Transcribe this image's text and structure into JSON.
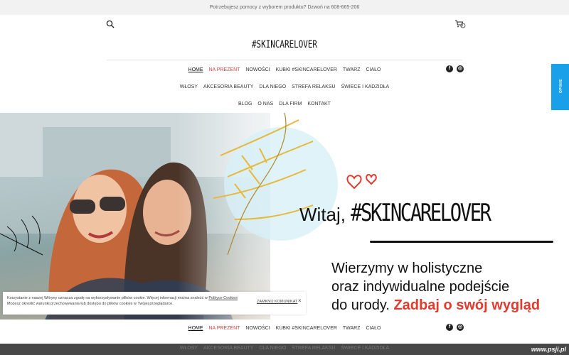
{
  "topbar": {
    "text": "Potrzebujesz pomocy z wyborem produktu? Dzwoń na 608-665-206"
  },
  "header": {
    "logo": "#SKINCARELOVER",
    "cart_count": "0",
    "search_icon": "search-icon",
    "cart_icon": "cart-icon"
  },
  "nav": {
    "row1": [
      "HOME",
      "NA PREZENT",
      "NOWOŚCI",
      "KUBKI #SKINCARELOVER",
      "TWARZ",
      "CIAŁO"
    ],
    "row2": [
      "WŁOSY",
      "AKCESORIA BEAUTY",
      "DLA NIEGO",
      "STREFA RELAKSU",
      "ŚWIECE I KADZIDŁA"
    ],
    "row3": [
      "BLOG",
      "O NAS",
      "DLA FIRM",
      "KONTAKT"
    ],
    "active_color": "#e0403a"
  },
  "social": {
    "facebook": "f",
    "instagram": "◎"
  },
  "side_tab": {
    "label": "OPINIE",
    "color": "#1aa0e8"
  },
  "hero": {
    "greeting": "Witaj,",
    "brand": "#SKINCARELOVER",
    "line1": "Wierzymy w holistyczne",
    "line2": "oraz indywidualne podejście",
    "line3_plain": "do urody.",
    "line3_highlight": "Zadbaj o swój wygląd",
    "accent_color": "#e23a2e"
  },
  "cookie": {
    "text1": "Korzystanie z naszej Witryny oznacza zgodę na wykorzystywanie plików cookie. Więcej informacji można znaleźć w",
    "link": "Polityce Cookies",
    "text2": "Możesz określić warunki przechowywania lub dostępu do plików cookies w Twojej przeglądarce.",
    "close_label": "ZAMKNIJ KOMUNIKAT",
    "close_x": "×"
  },
  "sticky_nav": {
    "row1": [
      "HOME",
      "NA PREZENT",
      "NOWOŚCI",
      "KUBKI #SKINCARELOVER",
      "TWARZ",
      "CIAŁO"
    ],
    "row2": [
      "WŁOSY",
      "AKCESORIA BEAUTY",
      "DLA NIEGO",
      "STREFA RELAKSU",
      "ŚWIECE I KADZIDŁA"
    ]
  },
  "watermark": "www.psji.pl"
}
